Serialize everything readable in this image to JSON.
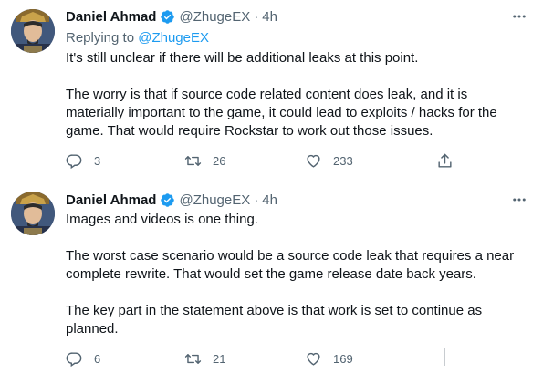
{
  "tweets": [
    {
      "author": {
        "name": "Daniel Ahmad",
        "handle": "@ZhugeEX",
        "time": "4h"
      },
      "separator": "·",
      "replying_prefix": "Replying to",
      "replying_to": "@ZhugeEX",
      "paragraphs": [
        "It's still unclear if there will be additional leaks at this point.",
        "The worry is that if source code related content does leak, and it is materially important to the game, it could lead to exploits / hacks for the game. That would require Rockstar to work out those issues."
      ],
      "stats": {
        "replies": "3",
        "retweets": "26",
        "likes": "233"
      },
      "icons": {
        "reply": "reply-icon",
        "retweet": "retweet-icon",
        "like": "heart-icon",
        "share": "share-icon",
        "more": "more-icon",
        "verified": "verified-badge-icon"
      }
    },
    {
      "author": {
        "name": "Daniel Ahmad",
        "handle": "@ZhugeEX",
        "time": "4h"
      },
      "separator": "·",
      "paragraphs": [
        "Images and videos is one thing.",
        "The worst case scenario would be a source code leak that requires a near complete rewrite. That would set the game release date back years.",
        "The key part in the statement above is that work is set to continue as planned."
      ],
      "stats": {
        "replies": "6",
        "retweets": "21",
        "likes": "169"
      },
      "icons": {
        "reply": "reply-icon",
        "retweet": "retweet-icon",
        "like": "heart-icon",
        "more": "more-icon",
        "verified": "verified-badge-icon"
      }
    }
  ],
  "colors": {
    "text": "#0f1419",
    "secondary": "#536471",
    "accent": "#1d9bf0",
    "divider": "#eff3f4"
  }
}
